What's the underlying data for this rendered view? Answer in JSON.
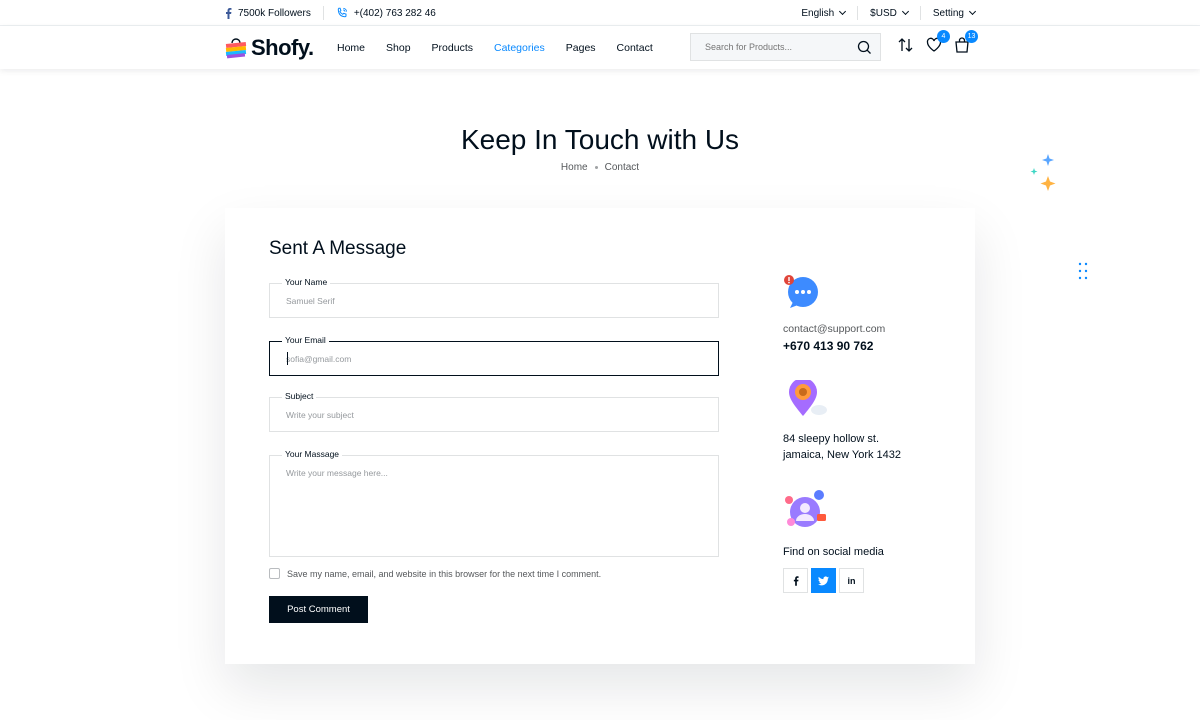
{
  "topbar": {
    "followers": "7500k Followers",
    "phone": "+(402) 763 282 46",
    "language": "English",
    "currency": "$USD",
    "setting": "Setting"
  },
  "header": {
    "logo": "Shofy.",
    "nav": [
      "Home",
      "Shop",
      "Products",
      "Categories",
      "Pages",
      "Contact"
    ],
    "active_nav": "Categories",
    "search_placeholder": "Search for Products...",
    "wishlist_count": "4",
    "cart_count": "13"
  },
  "hero": {
    "title": "Keep In Touch with Us",
    "crumb_home": "Home",
    "crumb_current": "Contact"
  },
  "form": {
    "title": "Sent A Message",
    "name_label": "Your Name",
    "name_placeholder": "Samuel Serif",
    "email_label": "Your Email",
    "email_placeholder": "sofia@gmail.com",
    "subject_label": "Subject",
    "subject_placeholder": "Write your subject",
    "message_label": "Your Massage",
    "message_placeholder": "Write your message here...",
    "remember_label": "Save my name, email, and website in this browser for the next time I comment.",
    "submit_label": "Post Comment"
  },
  "contact_info": {
    "email": "contact@support.com",
    "phone": "+670 413 90 762",
    "address_line1": "84 sleepy hollow st.",
    "address_line2": "jamaica, New York 1432",
    "social_heading": "Find on social media",
    "social": [
      "f",
      "t",
      "in"
    ]
  },
  "colors": {
    "accent": "#0989ff",
    "dark": "#010f1c",
    "muted": "#55585b"
  }
}
